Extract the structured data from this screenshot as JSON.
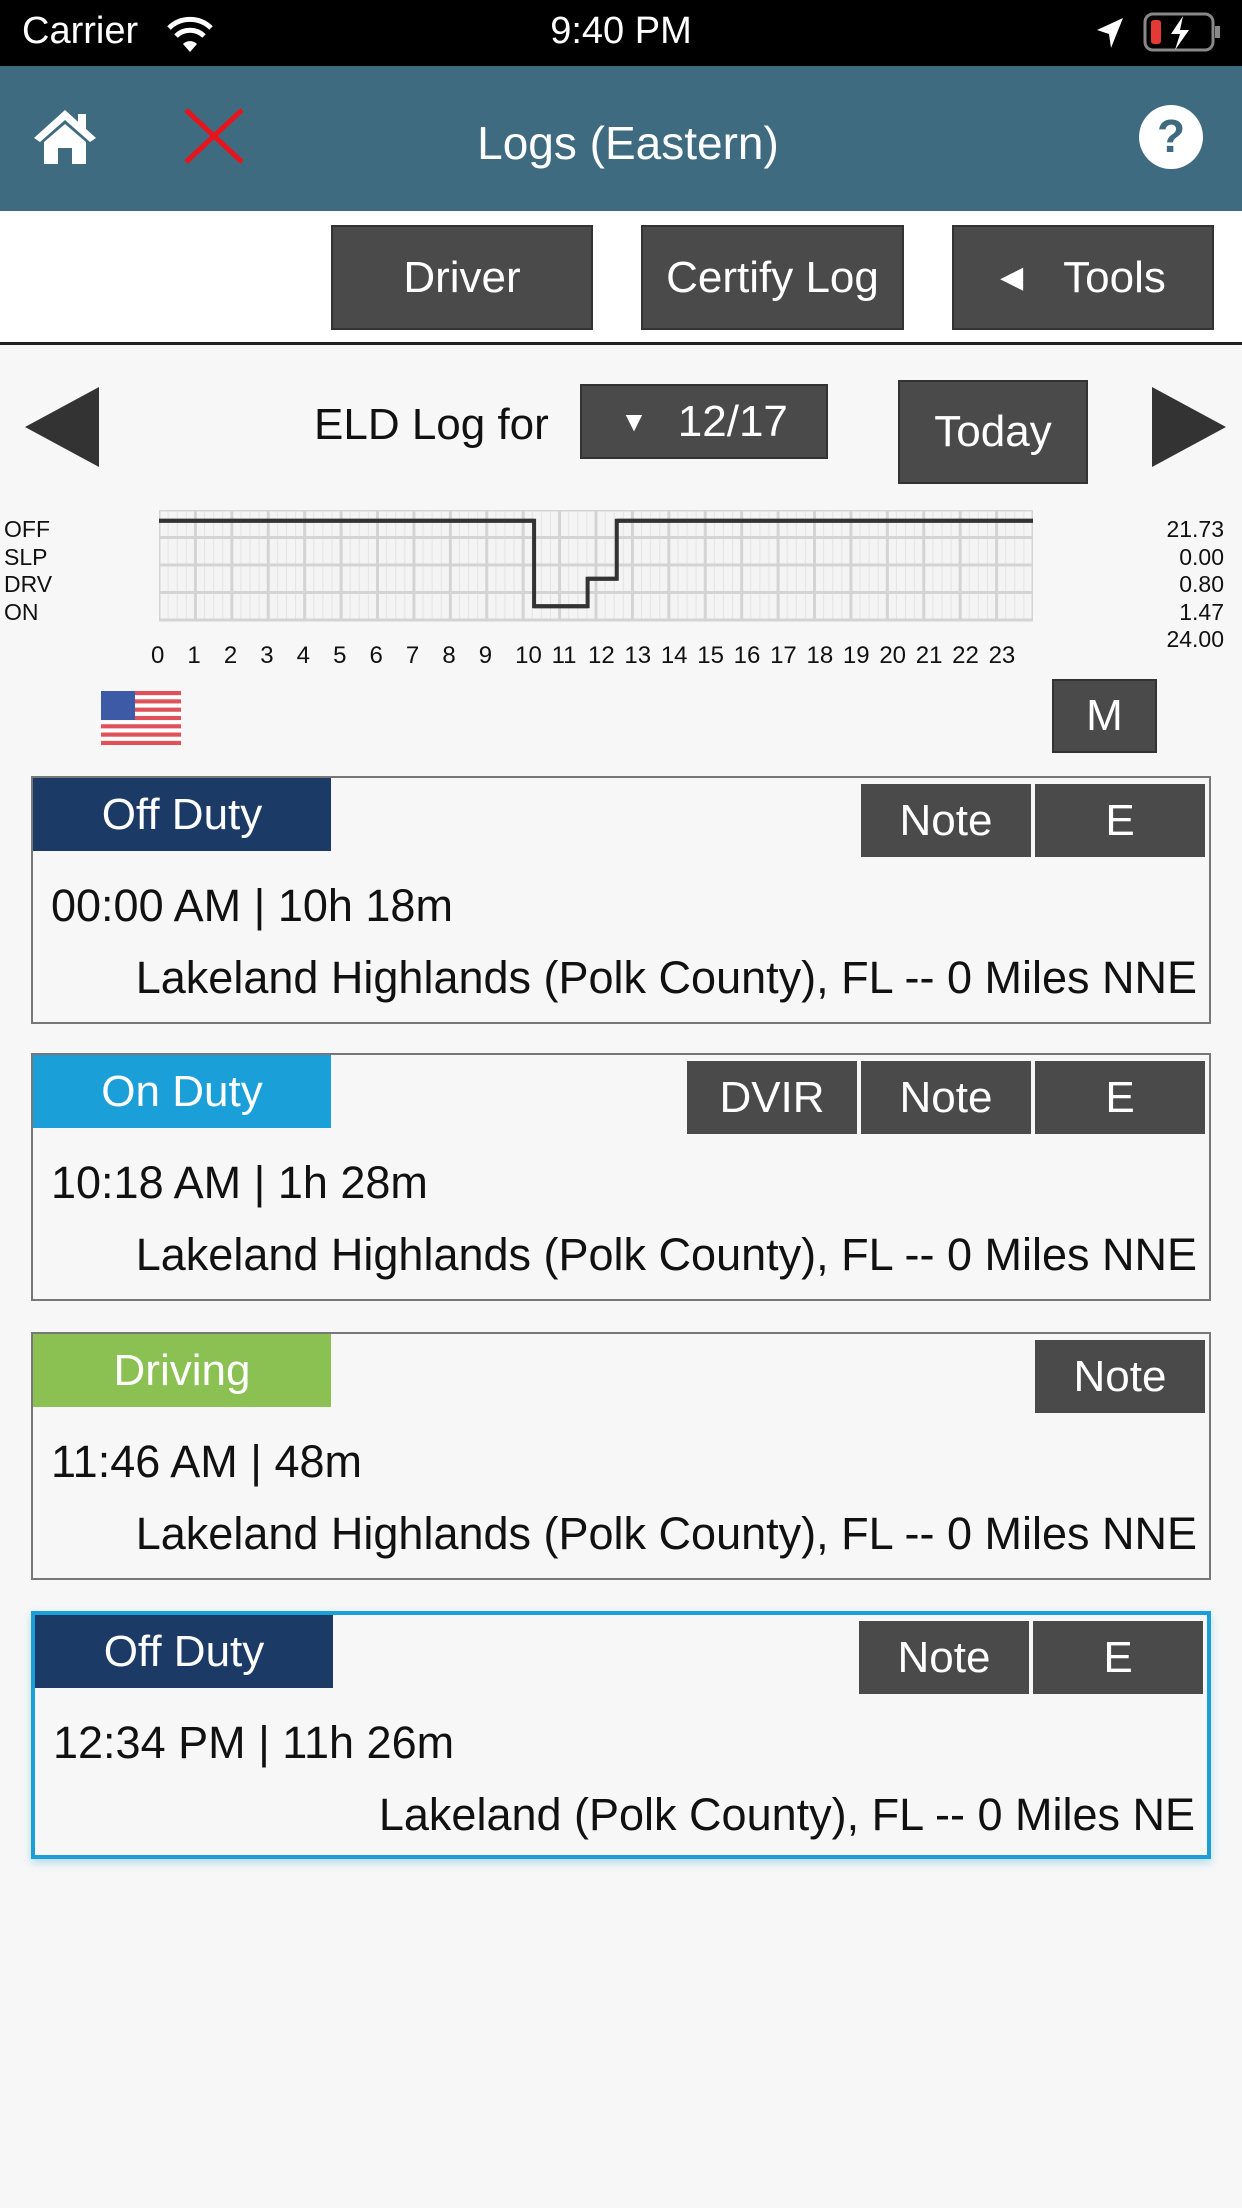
{
  "status_bar": {
    "carrier": "Carrier",
    "time": "9:40 PM"
  },
  "header": {
    "title": "Logs (Eastern)",
    "icons": [
      "home-icon",
      "close-icon",
      "help-icon"
    ]
  },
  "toolbar": {
    "driver": "Driver",
    "certify": "Certify Log",
    "tools": "Tools"
  },
  "nav": {
    "label": "ELD Log for",
    "date": "12/17",
    "today": "Today"
  },
  "chart_data": {
    "type": "line",
    "row_labels": [
      "OFF",
      "SLP",
      "DRV",
      "ON"
    ],
    "totals": [
      "21.73",
      "0.00",
      "0.80",
      "1.47",
      "24.00"
    ],
    "hour_labels": [
      "0",
      "1",
      "2",
      "3",
      "4",
      "5",
      "6",
      "7",
      "8",
      "9",
      "10",
      "11",
      "12",
      "13",
      "14",
      "15",
      "16",
      "17",
      "18",
      "19",
      "20",
      "21",
      "22",
      "23"
    ],
    "xlim": [
      0,
      24
    ],
    "segments": [
      {
        "status": "OFF",
        "start": 0,
        "end": 10.3
      },
      {
        "status": "ON",
        "start": 10.3,
        "end": 11.77
      },
      {
        "status": "DRV",
        "start": 11.77,
        "end": 12.57
      },
      {
        "status": "OFF",
        "start": 12.57,
        "end": 24
      }
    ]
  },
  "m_button": "M",
  "colors": {
    "off": "#1b3a66",
    "on": "#1a9fd8",
    "drv": "#8bc152",
    "header": "#3e6b80",
    "button": "#4a4a4a"
  },
  "events": [
    {
      "status": "Off Duty",
      "color": "#1b3a66",
      "time": "00:00 AM | 10h 18m",
      "location": "Lakeland Highlands (Polk County), FL -- 0 Miles NNE",
      "buttons": [
        "Note",
        "E"
      ]
    },
    {
      "status": "On Duty",
      "color": "#1a9fd8",
      "time": "10:18 AM | 1h 28m",
      "location": "Lakeland Highlands (Polk County), FL -- 0 Miles NNE",
      "buttons": [
        "DVIR",
        "Note",
        "E"
      ]
    },
    {
      "status": "Driving",
      "color": "#8bc152",
      "time": "11:46 AM | 48m",
      "location": "Lakeland Highlands (Polk County), FL -- 0 Miles NNE",
      "buttons": [
        "Note"
      ]
    },
    {
      "status": "Off Duty",
      "color": "#1b3a66",
      "time": "12:34 PM | 11h 26m",
      "location": "Lakeland (Polk County), FL -- 0 Miles NE",
      "buttons": [
        "Note",
        "E"
      ],
      "selected": true
    }
  ]
}
